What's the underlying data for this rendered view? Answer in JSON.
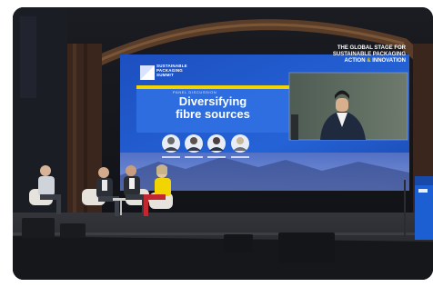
{
  "screen": {
    "event_logo_line1": "SUSTAINABLE",
    "event_logo_line2": "PACKAGING",
    "event_logo_line3": "SUMMIT",
    "tagline_line1_a": "THE ",
    "tagline_line1_b": "GLOBAL STAGE",
    "tagline_line1_c": " FOR",
    "tagline_line2": "SUSTAINABLE PACKAGING",
    "tagline_line3_a": "ACTION",
    "tagline_line3_b": " & ",
    "tagline_line3_c": "INNOVATION",
    "session_kicker": "PANEL DISCUSSION",
    "session_title_line1": "Diversifying",
    "session_title_line2": "fibre sources"
  },
  "colors": {
    "screen_blue": "#1e63d6",
    "accent_yellow": "#f2d400",
    "stage_floor": "#2a2b30",
    "curtain": "#3a261c"
  }
}
